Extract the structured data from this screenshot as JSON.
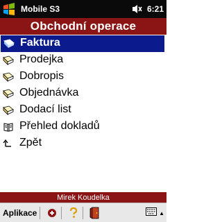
{
  "statusbar": {
    "title": "Mobile S3",
    "time": "6:21",
    "icons": [
      "windows-start-icon",
      "speaker-icon"
    ]
  },
  "header": {
    "title": "Obchodní operace"
  },
  "menu": {
    "items": [
      {
        "label": "Faktura",
        "icon": "invoice-icon",
        "selected": true
      },
      {
        "label": "Prodejka",
        "icon": "receipt-icon",
        "selected": false
      },
      {
        "label": "Dobropis",
        "icon": "credit-note-icon",
        "selected": false
      },
      {
        "label": "Objednávka",
        "icon": "order-icon",
        "selected": false
      },
      {
        "label": "Dodací list",
        "icon": "delivery-note-icon",
        "selected": false
      },
      {
        "label": "Přehled dokladů",
        "icon": "book-icon",
        "selected": false
      },
      {
        "label": "Zpět",
        "icon": "back-arrow-icon",
        "selected": false
      }
    ]
  },
  "footer": {
    "user": "Mirek Koudelka"
  },
  "cmdbar": {
    "menu_label": "Aplikace",
    "icons": [
      "app-icon",
      "help-icon",
      "exit-door-icon",
      "keyboard-icon",
      "chevron-up-icon"
    ]
  },
  "colors": {
    "header": "#8b1414",
    "selection": "#0b1a8c",
    "statusbar": "#0a0a0a"
  }
}
